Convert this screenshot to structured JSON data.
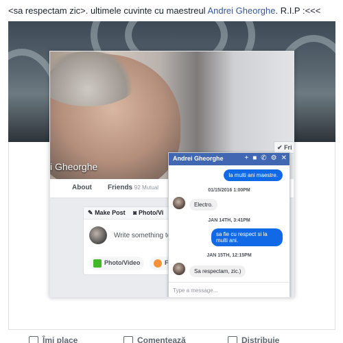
{
  "post": {
    "text_prefix": "<sa respectam zic>. ultimele cuvinte cu maestreul ",
    "link_name": "Andrei Gheorghe",
    "text_suffix": ". R.I.P :<<<"
  },
  "profile": {
    "cover_name": "i Gheorghe",
    "friends_button": "Fri"
  },
  "tabs": {
    "about": "About",
    "friends": "Friends",
    "friends_count": "92 Mutual"
  },
  "composer": {
    "make_post": "Make Post",
    "photo_video_tab": "Photo/Vi",
    "placeholder": "Write something to",
    "photo_video_chip": "Photo/Video",
    "second_chip": "F"
  },
  "chat": {
    "title": "Andrei Gheorghe",
    "icons": [
      "plus-icon",
      "video-icon",
      "phone-icon",
      "gear-icon",
      "close-icon"
    ],
    "messages": [
      {
        "type": "out",
        "text": "la multi ani maestre."
      },
      {
        "type": "timestamp",
        "text": "01/15/2016 1:00PM"
      },
      {
        "type": "in",
        "text": "Electro."
      },
      {
        "type": "timestamp",
        "text": "JAN 14TH, 3:41PM"
      },
      {
        "type": "out",
        "text": "sa fie cu respect si la multi ani."
      },
      {
        "type": "timestamp",
        "text": "JAN 15TH, 12:15PM"
      },
      {
        "type": "in",
        "text": "Sa respectam, zic.)"
      }
    ],
    "input_placeholder": "Type a message..."
  },
  "actions": {
    "like": "Îmi place",
    "comment": "Comentează",
    "share": "Distribuie"
  },
  "colors": {
    "chat_header": "#4267b2",
    "outgoing_bubble": "#1269e6",
    "link": "#365899"
  }
}
